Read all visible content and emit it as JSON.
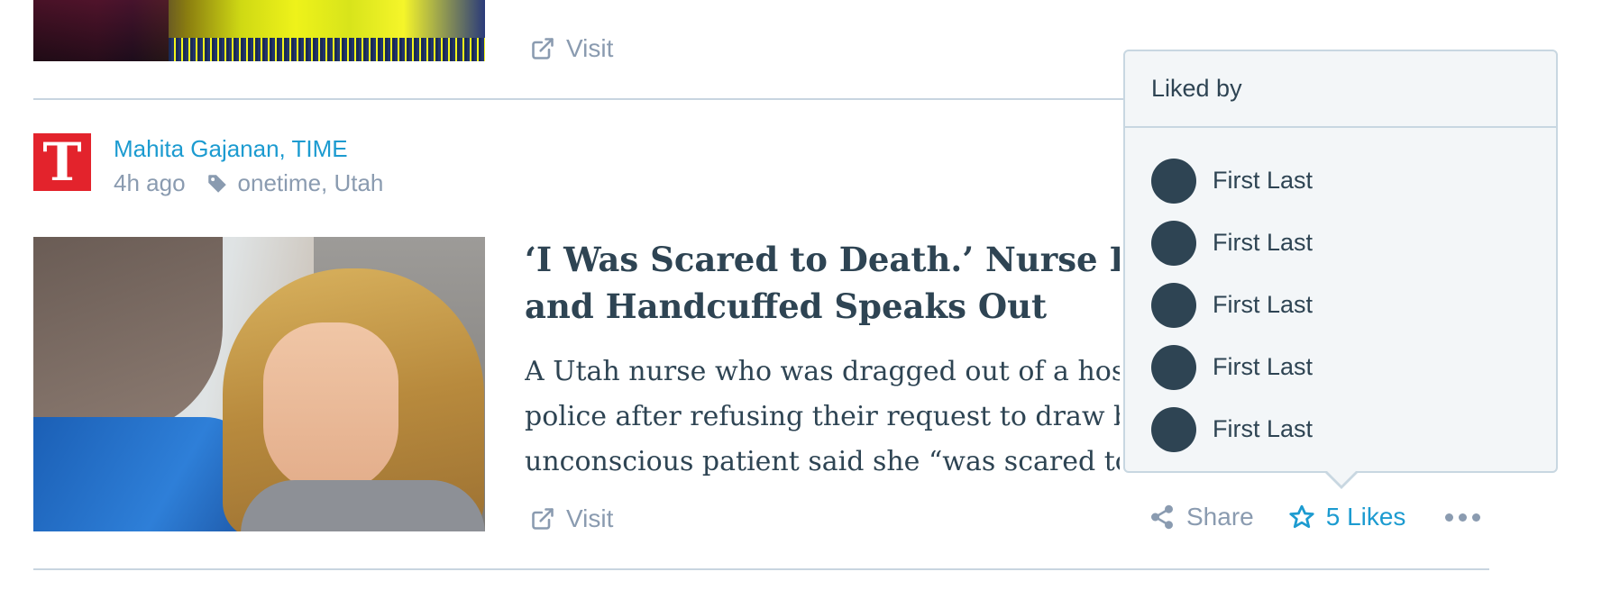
{
  "previous_post": {
    "visit_label": "Visit"
  },
  "post": {
    "site_icon_letter": "T",
    "author": "Mahita Gajanan, TIME",
    "time_ago": "4h ago",
    "tags": "onetime, Utah",
    "title_line1": "‘I Was Scared to Death.’ Nurse Dra",
    "title_line2": "and Handcuffed Speaks Out",
    "excerpt_line1": "A Utah nurse who was dragged out of a hos",
    "excerpt_line2": "police after refusing their request to draw b",
    "excerpt_line3": "unconscious patient said she “was scared to",
    "visit_label": "Visit",
    "share_label": "Share",
    "likes_label": "5 Likes"
  },
  "liked_by": {
    "title": "Liked by",
    "users": [
      {
        "name": "First Last"
      },
      {
        "name": "First Last"
      },
      {
        "name": "First Last"
      },
      {
        "name": "First Last"
      },
      {
        "name": "First Last"
      }
    ]
  },
  "colors": {
    "link_blue": "#1c9bd0",
    "text_dark": "#2e4453",
    "muted": "#8a9bb0",
    "site_icon_red": "#e3232c"
  },
  "icons": [
    "external-link-icon",
    "tag-icon",
    "share-icon",
    "star-icon",
    "ellipsis-icon"
  ]
}
